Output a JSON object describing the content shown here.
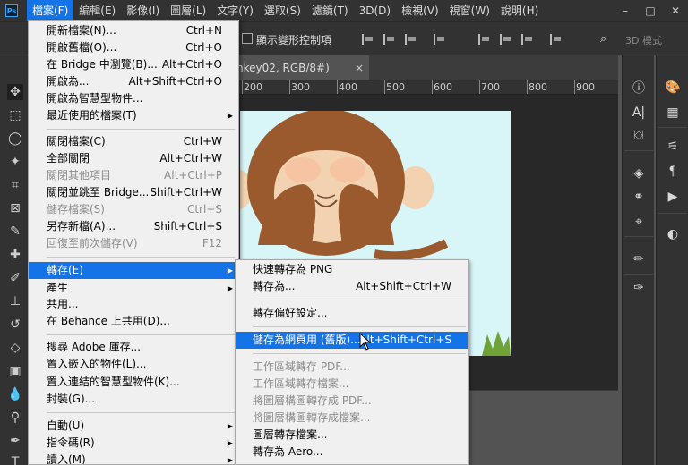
{
  "app": {
    "logo": "Ps"
  },
  "menubar": {
    "items": [
      "檔案(F)",
      "編輯(E)",
      "影像(I)",
      "圖層(L)",
      "文字(Y)",
      "選取(S)",
      "濾鏡(T)",
      "3D(D)",
      "檢視(V)",
      "視窗(W)",
      "說明(H)"
    ]
  },
  "window_controls": {
    "minimize": "–",
    "maximize": "□",
    "close": "✕"
  },
  "optionsbar": {
    "show_transform_label": "顯示變形控制項",
    "mode_3d_label": "3D 模式"
  },
  "document": {
    "tab_title": "nkey02, RGB/8#)",
    "tab_close": "×"
  },
  "ruler": {
    "ticks": [
      "200",
      "300",
      "400",
      "500",
      "600",
      "700",
      "800",
      "900"
    ]
  },
  "file_menu": {
    "items": [
      {
        "label": "開新檔案(N)...",
        "shortcut": "Ctrl+N"
      },
      {
        "label": "開啟舊檔(O)...",
        "shortcut": "Ctrl+O"
      },
      {
        "label": "在 Bridge 中瀏覽(B)...",
        "shortcut": "Alt+Ctrl+O"
      },
      {
        "label": "開啟為...",
        "shortcut": "Alt+Shift+Ctrl+O"
      },
      {
        "label": "開啟為智慧型物件...",
        "shortcut": ""
      },
      {
        "label": "最近使用的檔案(T)",
        "shortcut": "",
        "submenu": true
      },
      {
        "label": "關閉檔案(C)",
        "shortcut": "Ctrl+W"
      },
      {
        "label": "全部關閉",
        "shortcut": "Alt+Ctrl+W"
      },
      {
        "label": "關閉其他項目",
        "shortcut": "Alt+Ctrl+P",
        "disabled": true
      },
      {
        "label": "關閉並跳至 Bridge...",
        "shortcut": "Shift+Ctrl+W"
      },
      {
        "label": "儲存檔案(S)",
        "shortcut": "Ctrl+S",
        "disabled": true
      },
      {
        "label": "另存新檔(A)...",
        "shortcut": "Shift+Ctrl+S"
      },
      {
        "label": "回復至前次儲存(V)",
        "shortcut": "F12",
        "disabled": true
      },
      {
        "label": "轉存(E)",
        "shortcut": "",
        "submenu": true,
        "highlighted": true
      },
      {
        "label": "產生",
        "shortcut": "",
        "submenu": true
      },
      {
        "label": "共用...",
        "shortcut": ""
      },
      {
        "label": "在 Behance 上共用(D)...",
        "shortcut": ""
      },
      {
        "label": "搜尋 Adobe 庫存...",
        "shortcut": ""
      },
      {
        "label": "置入嵌入的物件(L)...",
        "shortcut": ""
      },
      {
        "label": "置入連結的智慧型物件(K)...",
        "shortcut": ""
      },
      {
        "label": "封裝(G)...",
        "shortcut": ""
      },
      {
        "label": "自動(U)",
        "shortcut": "",
        "submenu": true
      },
      {
        "label": "指令碼(R)",
        "shortcut": "",
        "submenu": true
      },
      {
        "label": "讀入(M)",
        "shortcut": "",
        "submenu": true
      }
    ]
  },
  "export_menu": {
    "items": [
      {
        "label": "快速轉存為 PNG",
        "shortcut": ""
      },
      {
        "label": "轉存為...",
        "shortcut": "Alt+Shift+Ctrl+W"
      },
      {
        "label": "轉存偏好設定...",
        "shortcut": ""
      },
      {
        "label": "儲存為網頁用 (舊版)...",
        "shortcut": "Alt+Shift+Ctrl+S",
        "highlighted": true
      },
      {
        "label": "工作區域轉存 PDF...",
        "shortcut": "",
        "disabled": true
      },
      {
        "label": "工作區域轉存檔案...",
        "shortcut": "",
        "disabled": true
      },
      {
        "label": "將圖層構圖轉存成 PDF...",
        "shortcut": "",
        "disabled": true
      },
      {
        "label": "將圖層構圖轉存成檔案...",
        "shortcut": "",
        "disabled": true
      },
      {
        "label": "圖層轉存檔案...",
        "shortcut": ""
      },
      {
        "label": "轉存為 Aero...",
        "shortcut": ""
      }
    ]
  },
  "colors": {
    "accent": "#1473e6",
    "chrome_dark": "#323232",
    "chrome_mid": "#535353",
    "menu_bg": "#f0f0f0",
    "canvas_bg": "#d8f5f7",
    "monkey_brown": "#9b5a2e"
  }
}
